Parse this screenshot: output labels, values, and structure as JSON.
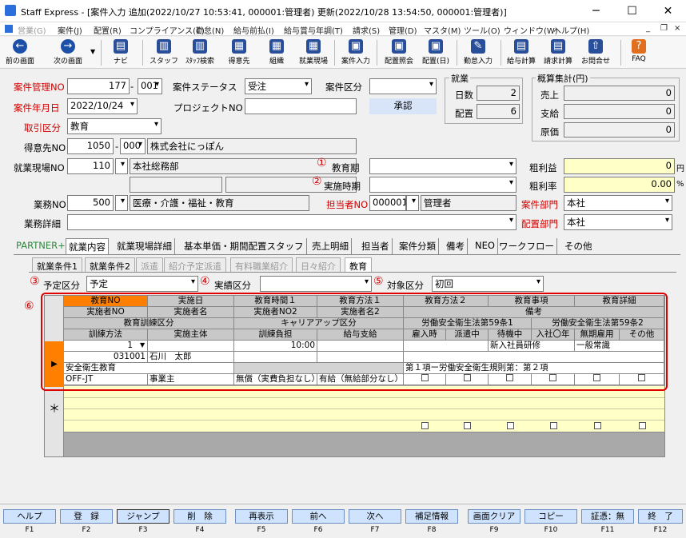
{
  "window": {
    "title": "Staff Express - [案件入力 追加(2022/10/27 10:53:41, 000001:管理者) 更新(2022/10/28 13:54:50, 000001:管理者)]",
    "minimize": "─",
    "maximize": "☐",
    "close": "✕"
  },
  "menu": [
    {
      "label": "営業(G)",
      "disabled": true
    },
    {
      "label": "案件(J)"
    },
    {
      "label": "配置(R)"
    },
    {
      "label": "コンプライアンス(C)"
    },
    {
      "label": "勤怠(N)"
    },
    {
      "label": "給与前払(I)"
    },
    {
      "label": "給与賞与年調(T)"
    },
    {
      "label": "請求(S)"
    },
    {
      "label": "管理(D)"
    },
    {
      "label": "マスタ(M)"
    },
    {
      "label": "ツール(O)"
    },
    {
      "label": "ウィンドウ(W)"
    },
    {
      "label": "ヘルプ(H)"
    }
  ],
  "toolbar": {
    "prev": "前の画面",
    "next": "次の画面",
    "nav": "ナビ",
    "staff": "スタッフ",
    "staff_search": "ｽﾀｯﾌ検索",
    "client": "得意先",
    "org": "組織",
    "site": "就業現場",
    "case_input": "案件入力",
    "assign_inquiry": "配置照会",
    "assign": "配置(日)",
    "attend": "勤怠入力",
    "pay_calc": "給与計算",
    "bill_calc": "請求計算",
    "contact": "お問合せ",
    "faq": "FAQ"
  },
  "form": {
    "case_no_label": "案件管理NO",
    "case_no": "177",
    "case_sub": "001",
    "status_label": "案件ステータス",
    "status": "受注",
    "category_label": "案件区分",
    "category": "",
    "date_label": "案件年月日",
    "date": "2022/10/24",
    "project_label": "プロジェクトNO",
    "project": "",
    "approve": "承認",
    "deal_label": "取引区分",
    "deal": "教育",
    "client_label": "得意先NO",
    "client_no": "1050",
    "client_sub": "000",
    "client_name": "株式会社にっぽん",
    "site_label": "就業現場NO",
    "site_no": "110",
    "site_name": "本社総務部",
    "edu_period_label": "教育期",
    "edu_period": "",
    "impl_period_label": "実施時期",
    "impl_period": "",
    "work_label": "業務NO",
    "work_no": "500",
    "work_name": "医療・介護・福祉・教育",
    "person_label": "担当者NO",
    "person_no": "000001",
    "person_name": "管理者",
    "work_detail_label": "業務詳細",
    "work_detail": "",
    "case_dept_label": "案件部門",
    "case_dept": "本社",
    "assign_dept_label": "配置部門",
    "assign_dept": "本社",
    "gross_label": "粗利益",
    "gross": "0",
    "gross_unit": "円",
    "rate_label": "粗利率",
    "rate": "0.00",
    "rate_unit": "%"
  },
  "employment": {
    "title": "就業",
    "days_label": "日数",
    "days": "2",
    "assign_label": "配置",
    "assign": "6"
  },
  "estimate": {
    "title": "概算集計(円)",
    "sales_label": "売上",
    "sales": "0",
    "pay_label": "支給",
    "pay": "0",
    "cost_label": "原価",
    "cost": "0"
  },
  "markers": {
    "m1": "①",
    "m2": "②",
    "m3": "③",
    "m4": "④",
    "m5": "⑤",
    "m6": "⑥"
  },
  "tabs": [
    "PARTNER+",
    "就業内容",
    "就業現場詳細",
    "基本単価・期間配置スタッフ",
    "売上明細",
    "担当者",
    "案件分類",
    "備考",
    "NEO",
    "ワークフロー",
    "その他"
  ],
  "subtabs": [
    {
      "label": "就業条件1"
    },
    {
      "label": "就業条件2"
    },
    {
      "label": "派遣",
      "disabled": true
    },
    {
      "label": "紹介予定派遣",
      "disabled": true
    },
    {
      "label": "有料職業紹介",
      "disabled": true
    },
    {
      "label": "日々紹介",
      "disabled": true
    },
    {
      "label": "教育"
    }
  ],
  "edu": {
    "plan_label": "予定区分",
    "plan": "予定",
    "actual_label": "実績区分",
    "actual": "",
    "target_label": "対象区分",
    "target": "初回"
  },
  "grid": {
    "h1": [
      "教育NO",
      "実施日",
      "教育時間１",
      "教育方法１",
      "教育方法２",
      "教育事項",
      "教育詳細"
    ],
    "h2": [
      "実施者NO",
      "実施者名",
      "実施者NO2",
      "実施者名2",
      "備考"
    ],
    "h3": [
      "教育訓練区分",
      "キャリアアップ区分",
      "労働安全衛生法第59条1",
      "労働安全衛生法第59条2"
    ],
    "h4": [
      "訓練方法",
      "実施主体",
      "訓練負担",
      "給与支給",
      "雇入時",
      "派遣中",
      "待機中",
      "入社〇年",
      "無期雇用",
      "その他"
    ],
    "row": {
      "no": "1",
      "time": "10:00",
      "subject": "新入社員研修",
      "detail": "一般常識",
      "inst_no": "031001",
      "inst_name": "石川　太郎",
      "cat": "安全衛生教育",
      "remarks": "第１項ー労働安全衛生規則第：第２項",
      "method": "OFF-JT",
      "body": "事業主",
      "burden": "無償（実費負担なし）",
      "pay": "有給（無給部分なし）"
    },
    "new_row_marker": "＊"
  },
  "fkeys": [
    {
      "label": "ヘルプ",
      "key": "F1"
    },
    {
      "label": "登　録",
      "key": "F2"
    },
    {
      "label": "ジャンプ",
      "key": "F3"
    },
    {
      "label": "削　除",
      "key": "F4"
    },
    {
      "label": "再表示",
      "key": "F5"
    },
    {
      "label": "前へ",
      "key": "F6"
    },
    {
      "label": "次へ",
      "key": "F7"
    },
    {
      "label": "補足情報",
      "key": "F8"
    },
    {
      "label": "画面クリア",
      "key": "F9"
    },
    {
      "label": "コピー",
      "key": "F10"
    },
    {
      "label": "証憑：無",
      "key": "F11"
    },
    {
      "label": "終　了",
      "key": "F12"
    }
  ],
  "colors": {
    "fkey_bg": "#cfe3ff",
    "header_orange": "#ff8000",
    "yellow": "#ffffc8",
    "highlight_border": "#e00000"
  }
}
